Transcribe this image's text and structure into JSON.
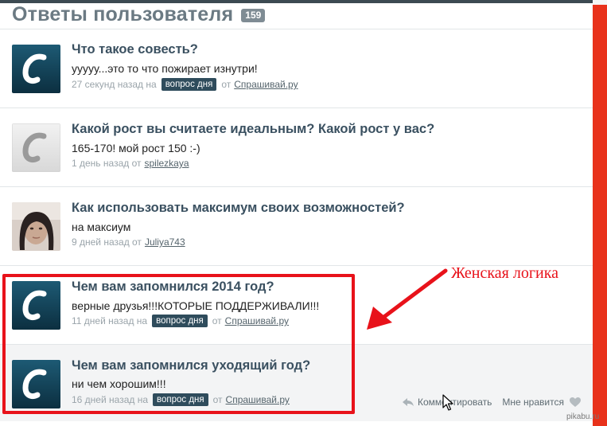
{
  "header": {
    "title": "Ответы пользователя",
    "count": "159"
  },
  "items": [
    {
      "question": "Что такое совесть?",
      "answer": "ууууу...это то что пожирает изнутри!",
      "time": "27 секунд назад на",
      "tag": "вопрос дня",
      "from_label": "от",
      "user": "Спрашивай.ру",
      "avatar": "logo-dark"
    },
    {
      "question": "Какой рост вы считаете идеальным? Какой рост у вас?",
      "answer": "165-170! мой рост 150 :-)",
      "time": "1 день назад от",
      "tag": "",
      "from_label": "",
      "user": "spilezkaya",
      "avatar": "logo-light"
    },
    {
      "question": "Как использовать максимум своих возможностей?",
      "answer": "на максиум",
      "time": "9 дней назад от",
      "tag": "",
      "from_label": "",
      "user": "Juliya743",
      "avatar": "photo"
    },
    {
      "question": "Чем вам запомнился 2014 год?",
      "answer": "верные друзья!!!КОТОРЫЕ ПОДДЕРЖИВАЛИ!!!",
      "time": "11 дней назад на",
      "tag": "вопрос дня",
      "from_label": "от",
      "user": "Спрашивай.ру",
      "avatar": "logo-dark"
    },
    {
      "question": "Чем вам запомнился уходящий год?",
      "answer": "ни чем хорошим!!!",
      "time": "16 дней назад на",
      "tag": "вопрос дня",
      "from_label": "от",
      "user": "Спрашивай.ру",
      "avatar": "logo-dark"
    }
  ],
  "actions": {
    "comment": "Комментировать",
    "like": "Мне нравится"
  },
  "annotation": {
    "text": "Женская логика",
    "color": "#e8121a"
  },
  "watermark": "pikabu.ru",
  "colors": {
    "accent_strip": "#e8321b",
    "tag_bg": "#2f4c5c",
    "title_text": "#3a5060"
  }
}
